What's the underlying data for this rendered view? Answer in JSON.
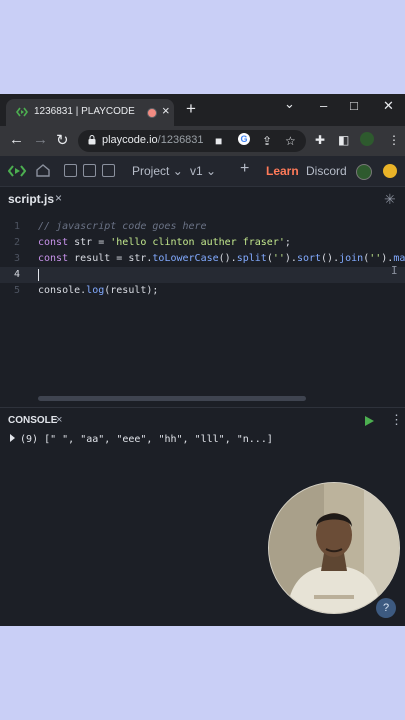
{
  "browser": {
    "tab_title": "1236831 | PLAYCODE",
    "tab_close": "×",
    "new_tab": "+",
    "url_domain": "playcode.io",
    "url_path": "/1236831",
    "win_minimize": "–",
    "win_maximize": "□",
    "win_close": "✕",
    "chevron": "⌄"
  },
  "app": {
    "project_label": "Project",
    "version_label": "v1",
    "plus": "+",
    "learn_label": "Learn",
    "discord_label": "Discord"
  },
  "editor": {
    "file_tab": "script.js",
    "file_tab_close": "×",
    "lines": [
      {
        "num": "1"
      },
      {
        "num": "2"
      },
      {
        "num": "3"
      },
      {
        "num": "4"
      },
      {
        "num": "5"
      }
    ],
    "code": {
      "l1_comment": "// javascript code goes here",
      "l2_kw": "const",
      "l2_var": " str = ",
      "l2_str": "'hello clinton auther fraser'",
      "l2_end": ";",
      "l3_kw": "const",
      "l3_var": " result = str.",
      "l3_fn1": "toLowerCase",
      "l3_p1": "().",
      "l3_fn2": "split",
      "l3_p2": "(",
      "l3_s1": "''",
      "l3_p3": ").",
      "l3_fn3": "sort",
      "l3_p4": "().",
      "l3_fn4": "join",
      "l3_p5": "(",
      "l3_s2": "''",
      "l3_p6": ").",
      "l3_fn5": "ma",
      "l5_a": "console.",
      "l5_fn": "log",
      "l5_b": "(result);"
    }
  },
  "console": {
    "title": "CONSOLE",
    "close": "×",
    "more": "⋮",
    "output": "(9) [\" \", \"aa\", \"eee\", \"hh\", \"lll\", \"n...]"
  },
  "help_label": "?",
  "colors": {
    "accent_learn": "#ff7a59",
    "run_green": "#4caf50",
    "page_bg": "#c9cff6"
  }
}
